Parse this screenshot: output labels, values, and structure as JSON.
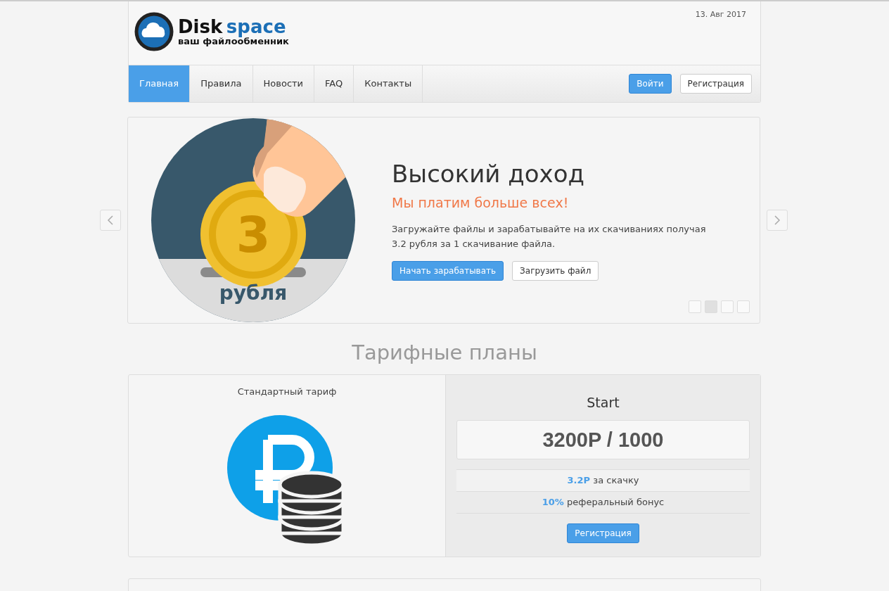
{
  "header": {
    "logo_word_1": "Disk",
    "logo_word_2": "space",
    "logo_tagline": "ваш файлообменник",
    "date": "13. Авг 2017"
  },
  "nav": {
    "items": [
      {
        "label": "Главная",
        "selected": true
      },
      {
        "label": "Правила",
        "selected": false
      },
      {
        "label": "Новости",
        "selected": false
      },
      {
        "label": "FAQ",
        "selected": false
      },
      {
        "label": "Контакты",
        "selected": false
      }
    ],
    "login": "Войти",
    "register": "Регистрация"
  },
  "slider": {
    "coin_digit": "3",
    "image_caption": "рубля",
    "title": "Высокий доход",
    "subtitle": "Мы платим больше всех!",
    "text": "Загружайте файлы и зарабатывайте на их скачиваниях получая 3.2 рубля за 1 скачивание файла.",
    "primary_button": "Начать зарабатывать",
    "secondary_button": "Загрузить файл",
    "dots": [
      {
        "selected": false
      },
      {
        "selected": true
      },
      {
        "selected": false
      },
      {
        "selected": false
      }
    ]
  },
  "plans": {
    "heading": "Тарифные планы",
    "plan_label": "Стандартный тариф",
    "name": "Start",
    "price": "3200P / 1000",
    "features": [
      "**3.2P** за скачку",
      "**10%** реферальный бонус"
    ],
    "button": "Регистрация"
  }
}
